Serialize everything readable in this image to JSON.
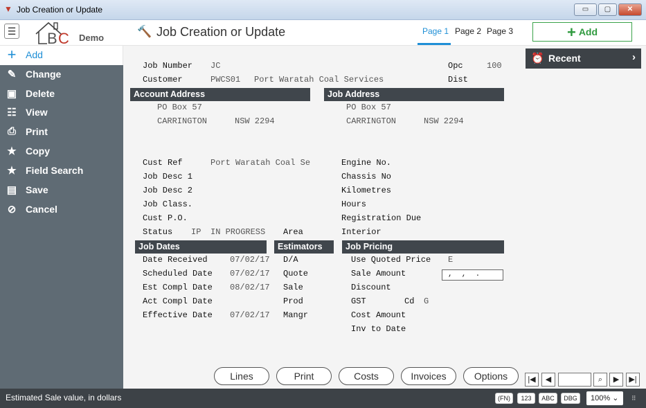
{
  "window": {
    "title": "Job Creation or Update",
    "min": "▭",
    "max": "▢",
    "close": "✕"
  },
  "header": {
    "logo_text": "Demo",
    "title": "Job Creation or Update",
    "pages": [
      "Page 1",
      "Page 2",
      "Page 3"
    ],
    "add_label": "Add",
    "menu_icon": "hamburger-icon"
  },
  "sidebar": {
    "items": [
      {
        "label": "Add",
        "icon": "plus-icon"
      },
      {
        "label": "Change",
        "icon": "pencil-icon"
      },
      {
        "label": "Delete",
        "icon": "trash-icon"
      },
      {
        "label": "View",
        "icon": "list-icon"
      },
      {
        "label": "Print",
        "icon": "printer-icon"
      },
      {
        "label": "Copy",
        "icon": "star-icon"
      },
      {
        "label": "Field Search",
        "icon": "star-icon"
      },
      {
        "label": "Save",
        "icon": "floppy-icon"
      },
      {
        "label": "Cancel",
        "icon": "ban-icon"
      }
    ]
  },
  "recent": {
    "label": "Recent"
  },
  "form": {
    "job_number_label": "Job Number",
    "job_number": "JC",
    "opc_label": "Opc",
    "opc": "100",
    "customer_label": "Customer",
    "customer_code": "PWCS01",
    "customer_name": "Port Waratah Coal Services",
    "dist_label": "Dist",
    "account_address": {
      "title": "Account Address",
      "line1": "PO Box 57",
      "city": "CARRINGTON",
      "state_pc": "NSW 2294"
    },
    "job_address": {
      "title": "Job Address",
      "line1": "PO Box 57",
      "city": "CARRINGTON",
      "state_pc": "NSW 2294"
    },
    "cust_ref_label": "Cust Ref",
    "cust_ref": "Port Waratah Coal Se",
    "job_desc1_label": "Job Desc 1",
    "job_desc2_label": "Job Desc 2",
    "job_class_label": "Job Class.",
    "cust_po_label": "Cust P.O.",
    "status_label": "Status",
    "status_code": "IP",
    "status_text": "IN PROGRESS",
    "area_label": "Area",
    "engine_label": "Engine No.",
    "chassis_label": "Chassis No",
    "km_label": "Kilometres",
    "hours_label": "Hours",
    "rego_label": "Registration Due",
    "interior_label": "Interior",
    "job_dates": {
      "title": "Job Dates",
      "rows": [
        {
          "label": "Date Received",
          "value": "07/02/17"
        },
        {
          "label": "Scheduled Date",
          "value": "07/02/17"
        },
        {
          "label": "Est Compl Date",
          "value": "08/02/17"
        },
        {
          "label": "Act Compl Date",
          "value": ""
        },
        {
          "label": "Effective Date",
          "value": "07/02/17"
        }
      ]
    },
    "estimators": {
      "title": "Estimators",
      "rows": [
        "D/A",
        "Quote",
        "Sale",
        "Prod",
        "Mangr"
      ]
    },
    "job_pricing": {
      "title": "Job Pricing",
      "use_quoted_label": "Use Quoted Price",
      "use_quoted": "E",
      "sale_amount_label": "Sale Amount",
      "sale_amount": ",  ,  .",
      "discount_label": "Discount",
      "gst_label": "GST",
      "cd_label": "Cd",
      "cd": "G",
      "cost_amount_label": "Cost Amount",
      "inv_to_date_label": "Inv to Date"
    }
  },
  "buttons": [
    "Lines",
    "Print",
    "Costs",
    "Invoices",
    "Options"
  ],
  "status": {
    "message": "Estimated Sale value, in dollars",
    "badges": [
      "(FN)",
      "123",
      "ABC",
      "DBG"
    ],
    "zoom": "100%"
  }
}
